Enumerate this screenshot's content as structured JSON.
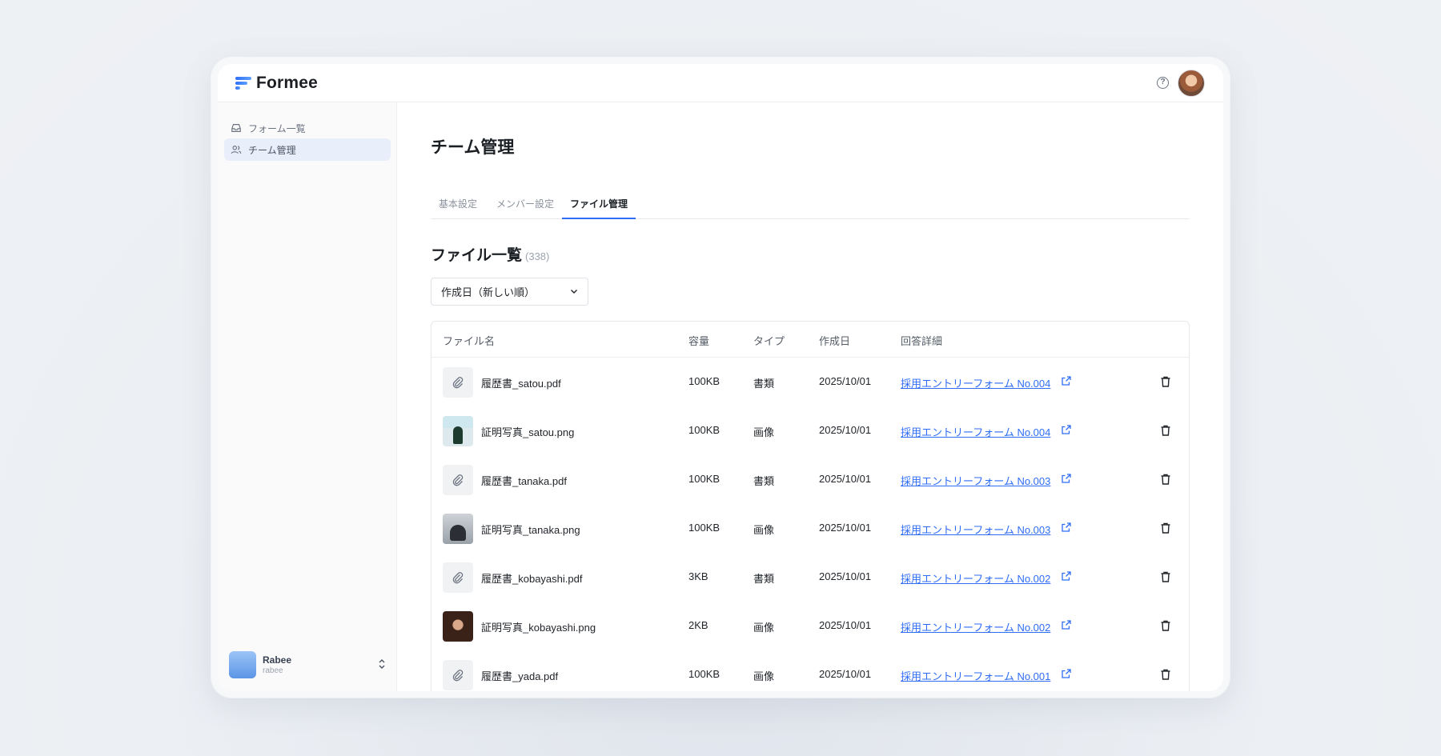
{
  "app": {
    "logo_text": "Formee",
    "help_glyph": "?",
    "accent": "#2f6df6"
  },
  "sidebar": {
    "items": [
      {
        "label": "フォーム一覧",
        "icon": "inbox-icon",
        "active": false
      },
      {
        "label": "チーム管理",
        "icon": "users-icon",
        "active": true
      }
    ],
    "user": {
      "name": "Rabee",
      "handle": "rabee"
    }
  },
  "main": {
    "title": "チーム管理",
    "tabs": [
      {
        "label": "基本設定",
        "active": false
      },
      {
        "label": "メンバー設定",
        "active": false
      },
      {
        "label": "ファイル管理",
        "active": true
      }
    ],
    "section_title": "ファイル一覧",
    "section_count": "(338)",
    "sort_value": "作成日（新しい順）"
  },
  "table": {
    "headers": {
      "name": "ファイル名",
      "size": "容量",
      "type": "タイプ",
      "created": "作成日",
      "detail": "回答詳細"
    },
    "rows": [
      {
        "name": "履歴書_satou.pdf",
        "size": "100KB",
        "type": "書類",
        "created": "2025/10/01",
        "detail": "採用エントリーフォーム No.004",
        "thumb": "paperclip-icon"
      },
      {
        "name": "証明写真_satou.png",
        "size": "100KB",
        "type": "画像",
        "created": "2025/10/01",
        "detail": "採用エントリーフォーム No.004",
        "thumb": "photo-thumbnail"
      },
      {
        "name": "履歴書_tanaka.pdf",
        "size": "100KB",
        "type": "書類",
        "created": "2025/10/01",
        "detail": "採用エントリーフォーム No.003",
        "thumb": "paperclip-icon"
      },
      {
        "name": "証明写真_tanaka.png",
        "size": "100KB",
        "type": "画像",
        "created": "2025/10/01",
        "detail": "採用エントリーフォーム No.003",
        "thumb": "photo-thumbnail"
      },
      {
        "name": "履歴書_kobayashi.pdf",
        "size": "3KB",
        "type": "書類",
        "created": "2025/10/01",
        "detail": "採用エントリーフォーム No.002",
        "thumb": "paperclip-icon"
      },
      {
        "name": "証明写真_kobayashi.png",
        "size": "2KB",
        "type": "画像",
        "created": "2025/10/01",
        "detail": "採用エントリーフォーム No.002",
        "thumb": "photo-thumbnail"
      },
      {
        "name": "履歴書_yada.pdf",
        "size": "100KB",
        "type": "画像",
        "created": "2025/10/01",
        "detail": "採用エントリーフォーム No.001",
        "thumb": "paperclip-icon"
      }
    ]
  }
}
